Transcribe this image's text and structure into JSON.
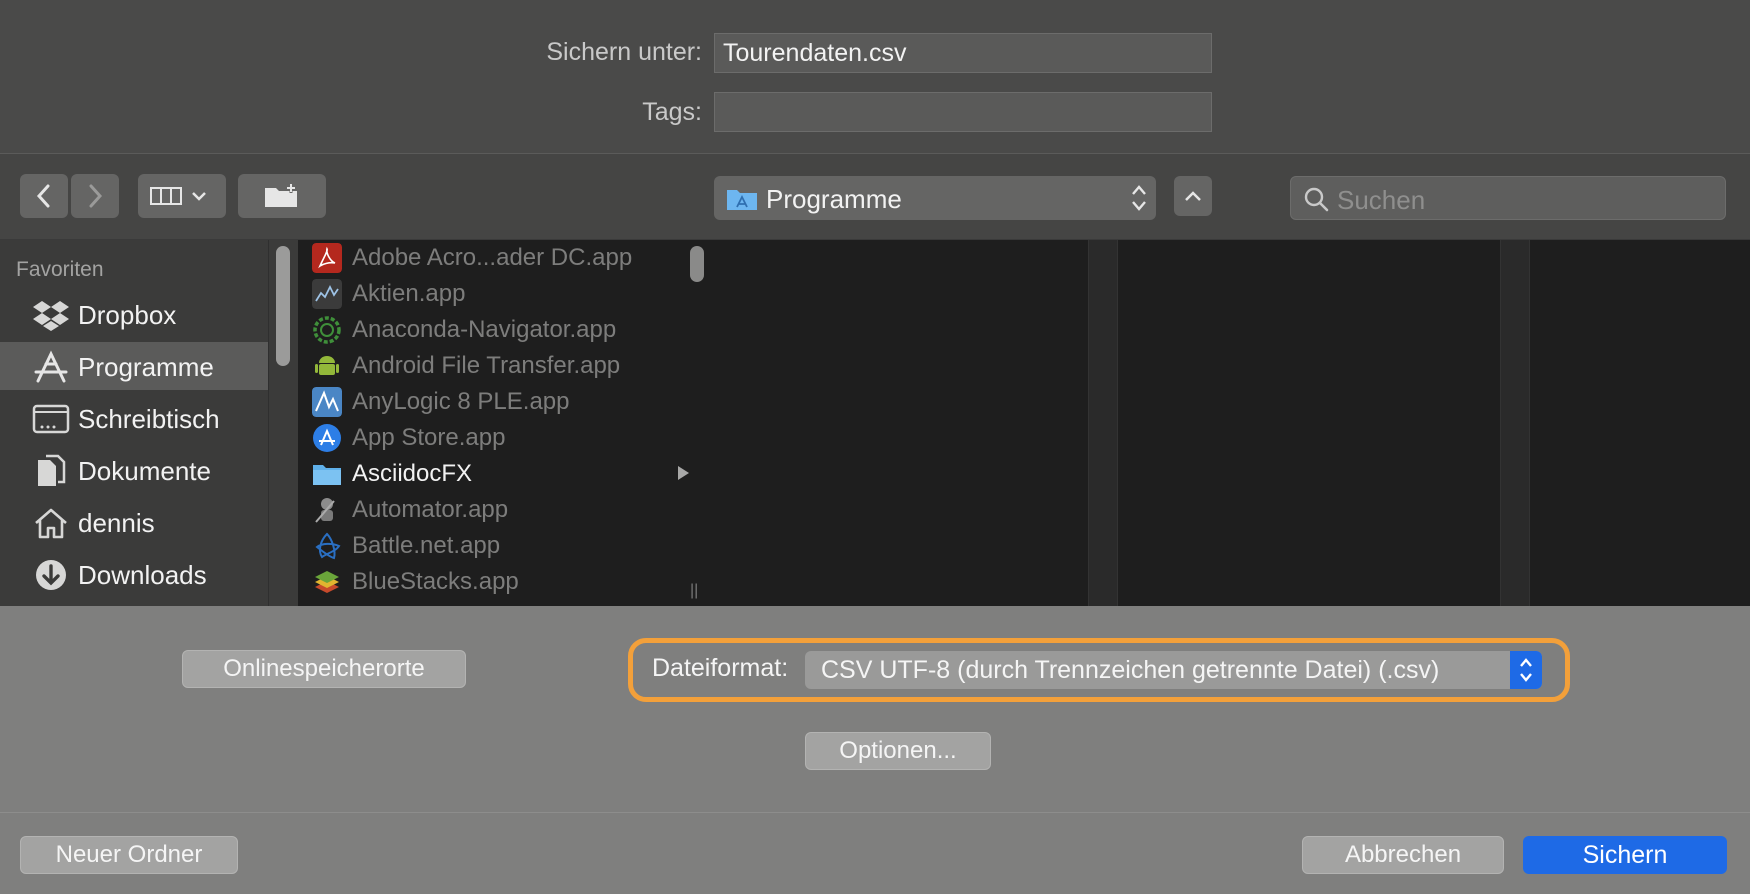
{
  "save_as": {
    "label": "Sichern unter:",
    "value": "Tourendaten.csv"
  },
  "tags": {
    "label": "Tags:",
    "value": ""
  },
  "toolbar": {
    "location": "Programme",
    "search_placeholder": "Suchen"
  },
  "sidebar": {
    "heading": "Favoriten",
    "items": [
      {
        "label": "Dropbox",
        "icon": "dropbox-icon",
        "selected": false
      },
      {
        "label": "Programme",
        "icon": "applications-icon",
        "selected": true
      },
      {
        "label": "Schreibtisch",
        "icon": "desktop-icon",
        "selected": false
      },
      {
        "label": "Dokumente",
        "icon": "documents-icon",
        "selected": false
      },
      {
        "label": "dennis",
        "icon": "home-icon",
        "selected": false
      },
      {
        "label": "Downloads",
        "icon": "downloads-icon",
        "selected": false
      }
    ]
  },
  "files": [
    {
      "name": "Adobe Acro...ader DC.app",
      "icon": "adobe-acrobat-icon",
      "color": "#b4281e",
      "folder": false
    },
    {
      "name": "Aktien.app",
      "icon": "stocks-icon",
      "color": "#3b3b3b",
      "folder": false
    },
    {
      "name": "Anaconda-Navigator.app",
      "icon": "anaconda-icon",
      "color": "#3f8f3a",
      "folder": false
    },
    {
      "name": "Android File Transfer.app",
      "icon": "android-icon",
      "color": "#93b83a",
      "folder": false
    },
    {
      "name": "AnyLogic 8 PLE.app",
      "icon": "anylogic-icon",
      "color": "#4a86c5",
      "folder": false
    },
    {
      "name": "App Store.app",
      "icon": "app-store-icon",
      "color": "#2d7ee6",
      "folder": false
    },
    {
      "name": "AsciidocFX",
      "icon": "folder-icon",
      "color": "#5fb0ea",
      "folder": true
    },
    {
      "name": "Automator.app",
      "icon": "automator-icon",
      "color": "#8c8c8c",
      "folder": false
    },
    {
      "name": "Battle.net.app",
      "icon": "battlenet-icon",
      "color": "#2a6fc2",
      "folder": false
    },
    {
      "name": "BlueStacks.app",
      "icon": "bluestacks-icon",
      "color": "#6aa53a",
      "folder": false
    }
  ],
  "bottom": {
    "online_locations": "Onlinespeicherorte",
    "format_label": "Dateiformat:",
    "format_value": "CSV UTF-8 (durch Trennzeichen getrennte Datei) (.csv)",
    "options": "Optionen...",
    "new_folder": "Neuer Ordner",
    "cancel": "Abbrechen",
    "save": "Sichern"
  },
  "colors": {
    "accent": "#1e6ae6",
    "highlight": "#f3a03a"
  }
}
